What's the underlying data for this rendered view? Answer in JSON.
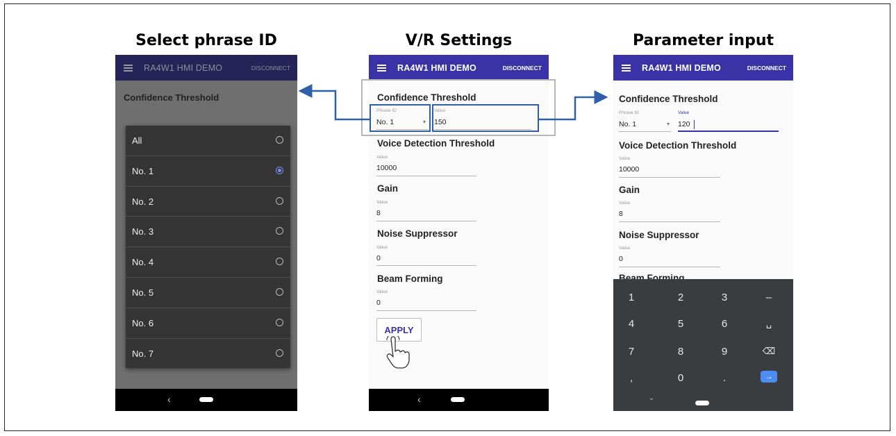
{
  "panels": {
    "left": {
      "title": "Select phrase ID"
    },
    "middle": {
      "title": "V/R Settings"
    },
    "right": {
      "title": "Parameter input"
    }
  },
  "app": {
    "title": "RA4W1 HMI DEMO",
    "disconnect_label": "DISCONNECT"
  },
  "labels": {
    "phrase_id": "Phrase ID",
    "value": "Value"
  },
  "sections": {
    "confidence": "Confidence Threshold",
    "voice_detection": "Voice Detection Threshold",
    "gain": "Gain",
    "noise_suppressor": "Noise Suppressor",
    "beam_forming": "Beam Forming"
  },
  "middle": {
    "phrase_id": "No. 1",
    "confidence_value": "150",
    "voice_detection_value": "10000",
    "gain_value": "8",
    "noise_suppressor_value": "0",
    "beam_forming_value": "0",
    "apply_label": "APPLY"
  },
  "right": {
    "phrase_id": "No. 1",
    "confidence_value": "120",
    "voice_detection_value": "10000",
    "gain_value": "8",
    "noise_suppressor_value": "0"
  },
  "dropdown": {
    "options": [
      "All",
      "No. 1",
      "No. 2",
      "No. 3",
      "No. 4",
      "No. 5",
      "No. 6",
      "No. 7"
    ],
    "selected": "No. 1"
  },
  "keypad": {
    "keys": [
      "1",
      "2",
      "3",
      "–",
      "4",
      "5",
      "6",
      "␣",
      "7",
      "8",
      "9",
      "⌫",
      ",",
      "0",
      ".",
      "→"
    ]
  },
  "colors": {
    "appbar": "#3a33a8",
    "highlight": "#2e5fa8",
    "accent": "#4b8df0"
  }
}
